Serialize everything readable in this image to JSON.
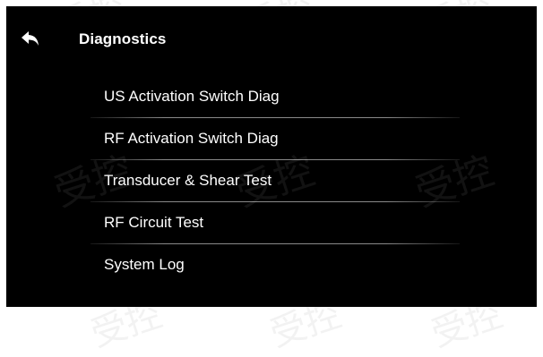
{
  "header": {
    "title": "Diagnostics",
    "back_icon": "back-arrow-icon"
  },
  "menu": {
    "items": [
      {
        "label": "US Activation Switch Diag"
      },
      {
        "label": "RF Activation Switch Diag"
      },
      {
        "label": "Transducer & Shear Test"
      },
      {
        "label": "RF Circuit Test"
      },
      {
        "label": "System Log"
      }
    ]
  },
  "watermark": {
    "text": "受控"
  },
  "colors": {
    "background": "#000000",
    "text": "#ffffff",
    "divider": "#8a8a8a",
    "frame": "#ffffff"
  }
}
